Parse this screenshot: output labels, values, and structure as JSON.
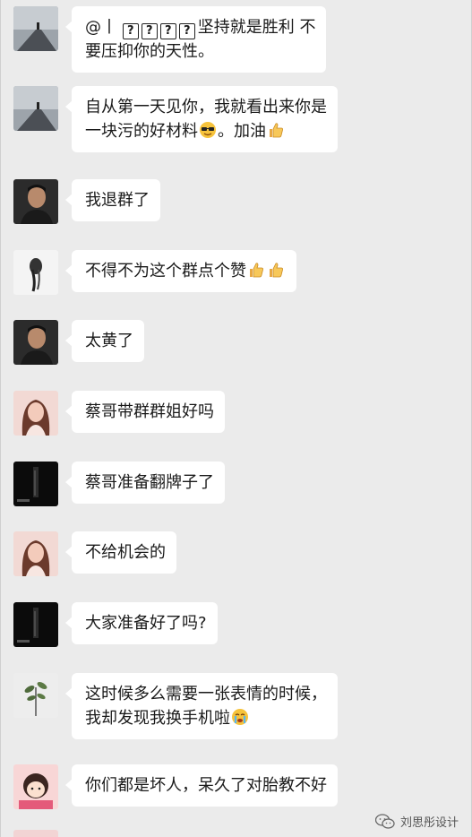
{
  "messages": [
    {
      "prefix": "@丨",
      "boxes": [
        "?",
        "?",
        "?",
        "?"
      ],
      "lines": [
        "坚持就是胜利 不",
        "要压抑你的天性。"
      ]
    },
    {
      "line1": "自从第一天见你，我就看出来你是",
      "line2_a": "一块污的好材料",
      "emoji1": "cool-sunglasses-emoji",
      "line2_b": "。加油",
      "emoji2": "thumbs-up-emoji"
    },
    {
      "text": "我退群了"
    },
    {
      "text": "不得不为这个群点个赞",
      "emojis": [
        "thumbs-up-emoji",
        "thumbs-up-emoji"
      ]
    },
    {
      "text": "太黄了"
    },
    {
      "text": "蔡哥带群群姐好吗"
    },
    {
      "text": "蔡哥准备翻牌子了"
    },
    {
      "text": "不给机会的"
    },
    {
      "text": "大家准备好了吗?"
    },
    {
      "line1": "这时候多么需要一张表情的时候，",
      "line2": "我却发现我换手机啦",
      "emoji": "crying-emoji"
    },
    {
      "text": "你们都是坏人，呆久了对胎教不好"
    }
  ],
  "watermark": {
    "text": "刘思彤设计",
    "icon": "wechat-logo-icon"
  },
  "colors": {
    "background": "#ebebeb",
    "bubble": "#ffffff",
    "text": "#1a1a1a"
  }
}
